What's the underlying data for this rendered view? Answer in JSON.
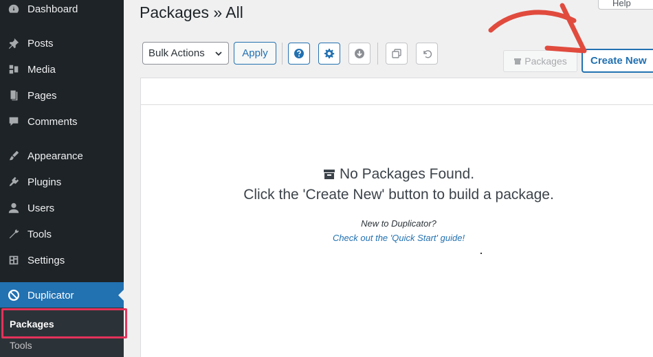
{
  "sidebar": {
    "items": [
      {
        "label": "Dashboard",
        "icon": "dashboard-icon"
      },
      {
        "label": "Posts",
        "icon": "pin-icon"
      },
      {
        "label": "Media",
        "icon": "media-icon"
      },
      {
        "label": "Pages",
        "icon": "pages-icon"
      },
      {
        "label": "Comments",
        "icon": "comment-icon"
      },
      {
        "label": "Appearance",
        "icon": "paintbrush-icon"
      },
      {
        "label": "Plugins",
        "icon": "plugin-icon"
      },
      {
        "label": "Users",
        "icon": "user-icon"
      },
      {
        "label": "Tools",
        "icon": "wrench-icon"
      },
      {
        "label": "Settings",
        "icon": "settings-icon"
      },
      {
        "label": "Duplicator",
        "icon": "duplicator-icon"
      }
    ],
    "submenu": {
      "current": "Packages",
      "next": "Tools"
    }
  },
  "header": {
    "title": "Packages » All",
    "help_label": "Help"
  },
  "toolbar": {
    "bulk_actions_label": "Bulk Actions",
    "apply_label": "Apply",
    "packages_label": "Packages",
    "create_new_label": "Create New"
  },
  "empty_state": {
    "heading": "No Packages Found.",
    "instruction": "Click the 'Create New' button to build a package.",
    "new_to": "New to Duplicator?",
    "guide_link": "Check out the 'Quick Start' guide!"
  },
  "colors": {
    "sidebar_bg": "#1d2327",
    "accent": "#2271b1",
    "highlight": "#e5325b",
    "arrow": "#e04b3e"
  }
}
